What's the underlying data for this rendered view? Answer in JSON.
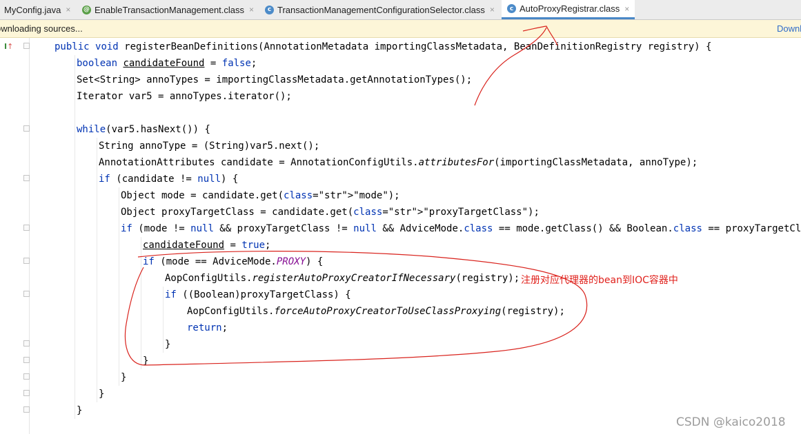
{
  "tabs": [
    {
      "label": "MyConfig.java",
      "icon": "java-file-icon"
    },
    {
      "label": "EnableTransactionManagement.class",
      "icon": "annotation-class-icon"
    },
    {
      "label": "TransactionManagementConfigurationSelector.class",
      "icon": "class-icon"
    },
    {
      "label": "AutoProxyRegistrar.class",
      "icon": "class-icon",
      "active": true
    }
  ],
  "close_glyph": "×",
  "notice": {
    "message": "ownloading sources...",
    "action": "Downl"
  },
  "annotation": {
    "note": "注册对应代理器的bean到IOC容器中",
    "color": "#e0201b"
  },
  "watermark": "CSDN @kaico2018",
  "code_lines": [
    "public void registerBeanDefinitions(AnnotationMetadata importingClassMetadata, BeanDefinitionRegistry registry) {",
    "boolean candidateFound = false;",
    "Set<String> annoTypes = importingClassMetadata.getAnnotationTypes();",
    "Iterator var5 = annoTypes.iterator();",
    "while(var5.hasNext()) {",
    "String annoType = (String)var5.next();",
    "AnnotationAttributes candidate = AnnotationConfigUtils.attributesFor(importingClassMetadata, annoType);",
    "if (candidate != null) {",
    "Object mode = candidate.get(\"mode\");",
    "Object proxyTargetClass = candidate.get(\"proxyTargetClass\");",
    "if (mode != null && proxyTargetClass != null && AdviceMode.class == mode.getClass() && Boolean.class == proxyTargetClass.get",
    "candidateFound = true;",
    "if (mode == AdviceMode.PROXY) {",
    "AopConfigUtils.registerAutoProxyCreatorIfNecessary(registry);",
    "if ((Boolean)proxyTargetClass) {",
    "AopConfigUtils.forceAutoProxyCreatorToUseClassProxying(registry);",
    "return;",
    "}",
    "}",
    "}",
    "}",
    "}"
  ],
  "colors": {
    "keyword": "#0033b3",
    "string": "#067d17",
    "constant": "#871094",
    "tab_accent": "#4a88c7"
  }
}
